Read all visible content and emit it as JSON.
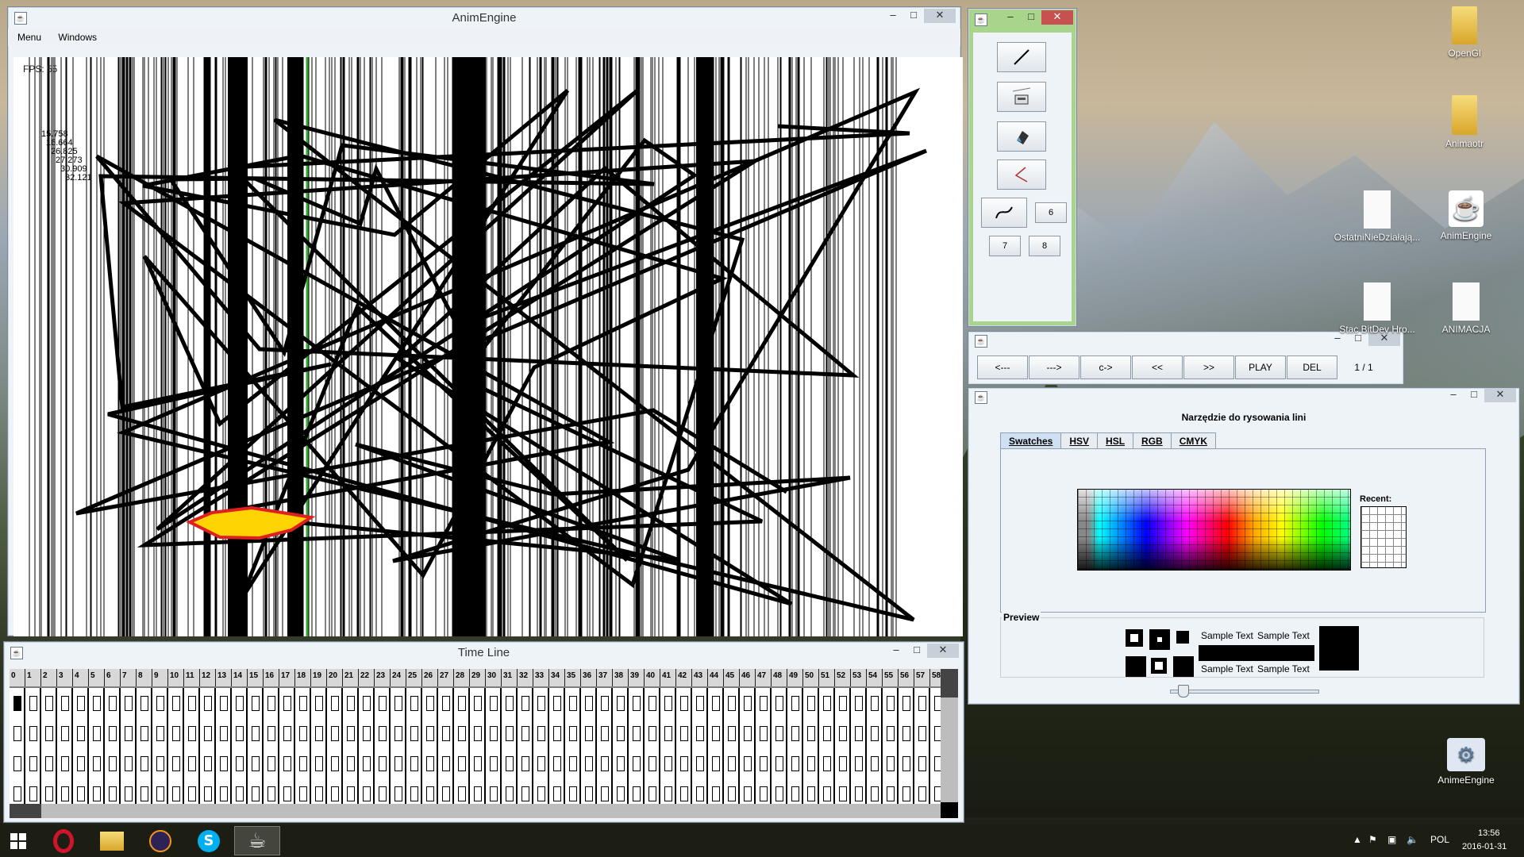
{
  "main_window": {
    "title": "AnimEngine",
    "menu": [
      "Menu",
      "Windows"
    ],
    "fps": "FPS: 55",
    "overlay_numbers": [
      "15.758",
      "16.664",
      "26.825",
      "27.273",
      "30.909",
      "32.121"
    ]
  },
  "tools_window": {
    "buttons": [
      "line-tool",
      "stamp-tool",
      "bucket-tool",
      "pen-tool",
      "curve-tool"
    ],
    "labels": [
      "6",
      "7",
      "8"
    ]
  },
  "nav_window": {
    "buttons": [
      "<---",
      "--->",
      "c->",
      "<<",
      ">>",
      "PLAY",
      "DEL"
    ],
    "frame_counter": "1 / 1"
  },
  "color_window": {
    "title": "Narzędzie do rysowania lini",
    "tabs": [
      "Swatches",
      "HSV",
      "HSL",
      "RGB",
      "CMYK"
    ],
    "recent_label": "Recent:",
    "preview_label": "Preview",
    "sample_text": "Sample Text"
  },
  "timeline": {
    "title": "Time Line",
    "frames": [
      "0",
      "1",
      "2",
      "3",
      "4",
      "5",
      "6",
      "7",
      "8",
      "9",
      "10",
      "11",
      "12",
      "13",
      "14",
      "15",
      "16",
      "17",
      "18",
      "19",
      "20",
      "21",
      "22",
      "23",
      "24",
      "25",
      "26",
      "27",
      "28",
      "29",
      "30",
      "31",
      "32",
      "33",
      "34",
      "35",
      "36",
      "37",
      "38",
      "39",
      "40",
      "41",
      "42",
      "43",
      "44",
      "45",
      "46",
      "47",
      "48",
      "49",
      "50",
      "51",
      "52",
      "53",
      "54",
      "55",
      "56",
      "57",
      "58"
    ]
  },
  "desktop_icons": [
    {
      "label": "OpenGl",
      "type": "folder"
    },
    {
      "label": "Animaotr",
      "type": "folder"
    },
    {
      "label": "OstatniNieDziałają...",
      "type": "file"
    },
    {
      "label": "AnimEngine",
      "type": "java"
    },
    {
      "label": "Stac BitDev Hro...",
      "type": "file"
    },
    {
      "label": "ANIMACJA",
      "type": "file"
    },
    {
      "label": "AnimeEngine",
      "type": "settings"
    }
  ],
  "taskbar": {
    "apps": [
      "opera",
      "file-explorer",
      "eclipse",
      "skype",
      "java"
    ],
    "language": "POL",
    "time": "13:56",
    "date": "2016-01-31"
  }
}
